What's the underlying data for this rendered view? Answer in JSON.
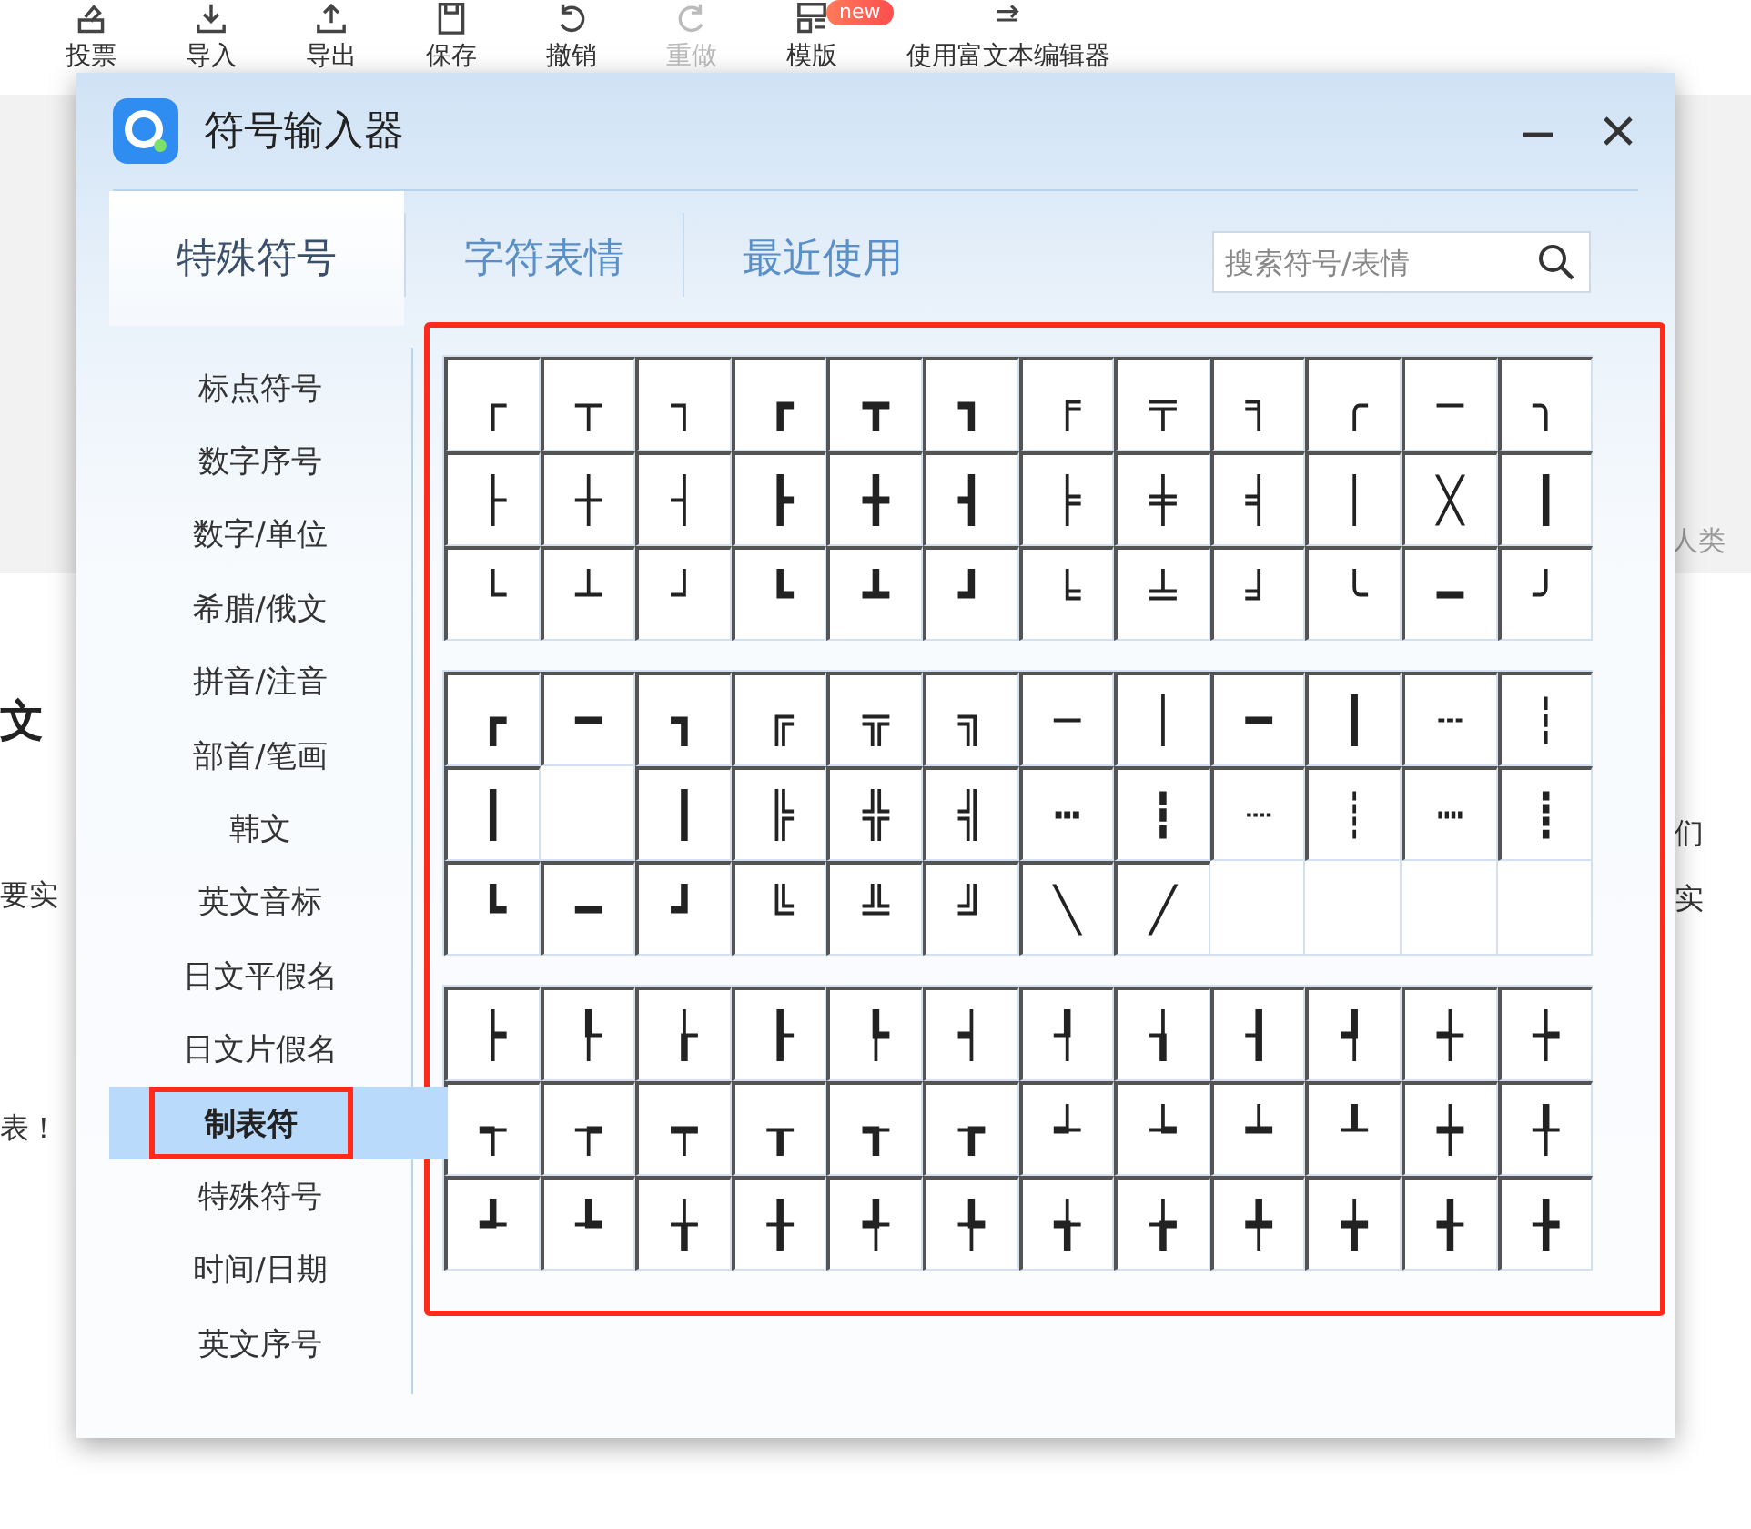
{
  "toolbar": {
    "items": [
      {
        "label": "投票",
        "disabled": false
      },
      {
        "label": "导入",
        "disabled": false
      },
      {
        "label": "导出",
        "disabled": false
      },
      {
        "label": "保存",
        "disabled": false
      },
      {
        "label": "撤销",
        "disabled": false
      },
      {
        "label": "重做",
        "disabled": true
      },
      {
        "label": "模版",
        "disabled": false,
        "badge": "new"
      },
      {
        "label": "使用富文本编辑器",
        "disabled": false
      }
    ]
  },
  "page": {
    "heading": "文",
    "left_lines": [
      "要实",
      "表！"
    ],
    "right_lines": [
      "们",
      "实"
    ],
    "band_text": "人类"
  },
  "dialog": {
    "title": "符号输入器",
    "tabs": [
      {
        "label": "特殊符号",
        "selected": true
      },
      {
        "label": "字符表情",
        "selected": false
      },
      {
        "label": "最近使用",
        "selected": false
      }
    ],
    "search": {
      "placeholder": "搜索符号/表情"
    },
    "categories": [
      {
        "label": "标点符号",
        "selected": false,
        "annotated": false
      },
      {
        "label": "数字序号",
        "selected": false,
        "annotated": false
      },
      {
        "label": "数字/单位",
        "selected": false,
        "annotated": false
      },
      {
        "label": "希腊/俄文",
        "selected": false,
        "annotated": false
      },
      {
        "label": "拼音/注音",
        "selected": false,
        "annotated": false
      },
      {
        "label": "部首/笔画",
        "selected": false,
        "annotated": false
      },
      {
        "label": "韩文",
        "selected": false,
        "annotated": false
      },
      {
        "label": "英文音标",
        "selected": false,
        "annotated": false
      },
      {
        "label": "日文平假名",
        "selected": false,
        "annotated": false
      },
      {
        "label": "日文片假名",
        "selected": false,
        "annotated": false
      },
      {
        "label": "制表符",
        "selected": true,
        "annotated": true
      },
      {
        "label": "特殊符号",
        "selected": false,
        "annotated": false
      },
      {
        "label": "时间/日期",
        "selected": false,
        "annotated": false
      },
      {
        "label": "英文序号",
        "selected": false,
        "annotated": false
      }
    ],
    "symbol_panel": {
      "annotated": true,
      "groups": [
        {
          "rows": [
            [
              "┌",
              "┬",
              "┐",
              "┏",
              "┳",
              "┓",
              "╒",
              "╤",
              "╕",
              "╭",
              "─",
              "╮"
            ],
            [
              "├",
              "┼",
              "┤",
              "┣",
              "╋",
              "┫",
              "╞",
              "╪",
              "╡",
              "│",
              "╳",
              "┃"
            ],
            [
              "└",
              "┴",
              "┘",
              "┗",
              "┻",
              "┛",
              "╘",
              "╧",
              "╛",
              "╰",
              "━",
              "╯"
            ]
          ]
        },
        {
          "rows": [
            [
              "┏",
              "━",
              "┓",
              "╔",
              "╦",
              "╗",
              "─",
              "│",
              "━",
              "┃",
              "┄",
              "┆"
            ],
            [
              "┃",
              null,
              "┃",
              "╠",
              "╬",
              "╣",
              "┅",
              "┇",
              "┈",
              "┊",
              "┉",
              "┋"
            ],
            [
              "┗",
              "━",
              "┛",
              "╚",
              "╩",
              "╝",
              "╲",
              "╱",
              null,
              null,
              null,
              null
            ]
          ]
        },
        {
          "rows": [
            [
              "┝",
              "┞",
              "┟",
              "┠",
              "┡",
              "┥",
              "┦",
              "┧",
              "┨",
              "┩",
              "┽",
              "┾"
            ],
            [
              "┭",
              "┮",
              "┯",
              "┰",
              "┱",
              "┲",
              "┵",
              "┶",
              "┷",
              "┸",
              "┿",
              "╀"
            ],
            [
              "┹",
              "┺",
              "╁",
              "╂",
              "╃",
              "╄",
              "╅",
              "╆",
              "╇",
              "╈",
              "╉",
              "╊"
            ]
          ]
        }
      ]
    }
  }
}
